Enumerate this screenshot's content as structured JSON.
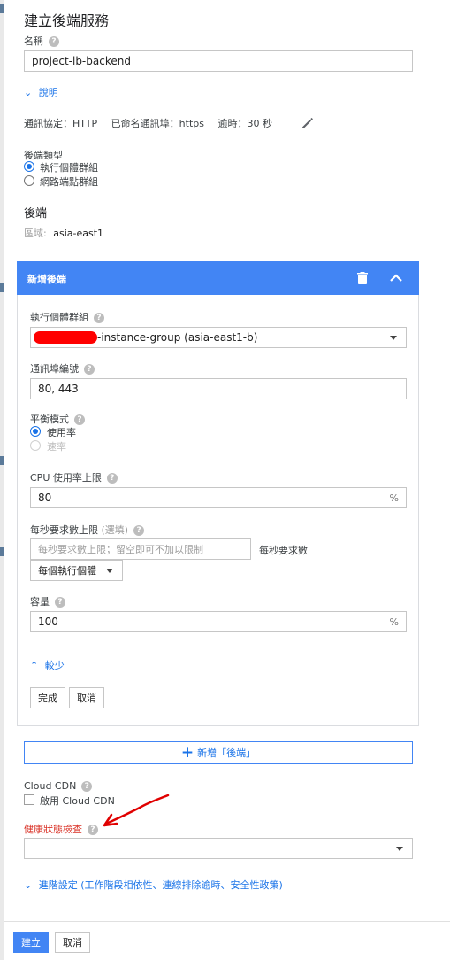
{
  "page": {
    "title": "建立後端服務"
  },
  "name_field": {
    "label": "名稱",
    "value": "project-lb-backend"
  },
  "description_link": "說明",
  "protocol_summary": {
    "protocol": "通訊協定：HTTP",
    "named_port": "已命名通訊埠：https",
    "timeout": "逾時：30 秒"
  },
  "backend_type": {
    "label": "後端類型",
    "options": [
      "執行個體群組",
      "網路端點群組"
    ],
    "selected": 0
  },
  "backends": {
    "heading": "後端",
    "region_label": "區域:",
    "region_value": "asia-east1"
  },
  "new_backend": {
    "header": "新增後端",
    "instance_group": {
      "label": "執行個體群組",
      "value": "-instance-group (asia-east1-b)"
    },
    "port_numbers": {
      "label": "通訊埠編號",
      "value": "80, 443"
    },
    "balancing_mode": {
      "label": "平衡模式",
      "options": [
        "使用率",
        "速率"
      ],
      "selected": 0
    },
    "cpu_limit": {
      "label": "CPU 使用率上限",
      "value": "80",
      "unit": "%"
    },
    "rps_limit": {
      "label": "每秒要求數上限",
      "optional": "(選填)",
      "placeholder": "每秒要求數上限；留空即可不加以限制",
      "suffix": "每秒要求數",
      "per_select": "每個執行個體"
    },
    "capacity": {
      "label": "容量",
      "value": "100",
      "unit": "%"
    },
    "less_link": "較少",
    "done": "完成",
    "cancel": "取消"
  },
  "add_backend_button": "新增「後端」",
  "cloud_cdn": {
    "label": "Cloud CDN",
    "checkbox": "啟用 Cloud CDN"
  },
  "health_check": {
    "label": "健康狀態檢查",
    "value": ""
  },
  "advanced_link": "進階設定 (工作階段相依性、連線排除逾時、安全性政策)",
  "footer": {
    "create": "建立",
    "cancel": "取消"
  },
  "colors": {
    "accent": "#4285f4",
    "error": "#d93025",
    "annotation": "#e00000"
  }
}
